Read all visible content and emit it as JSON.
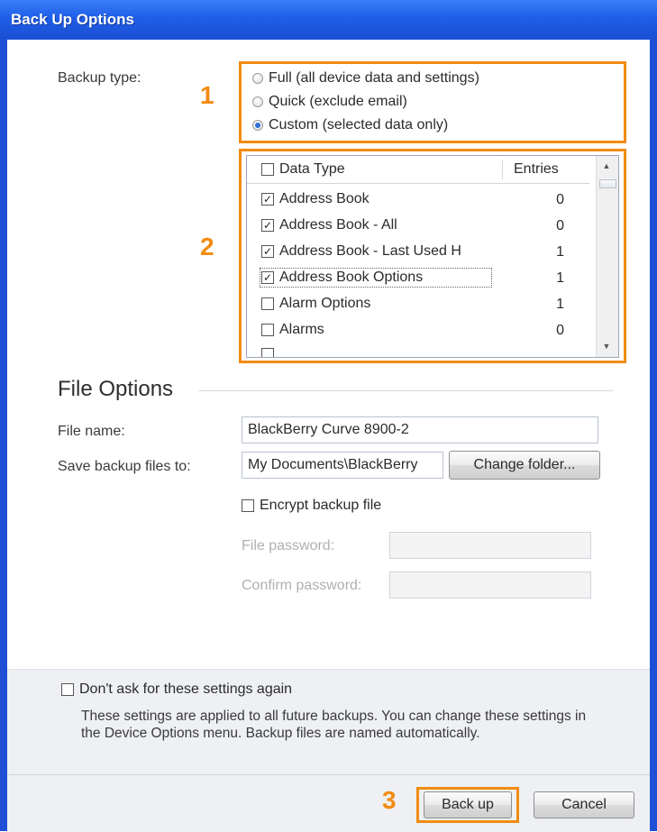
{
  "window": {
    "title": "Back Up Options"
  },
  "backup_type": {
    "label": "Backup type:",
    "options": [
      {
        "label": "Full (all device data and settings)",
        "selected": false
      },
      {
        "label": "Quick (exclude email)",
        "selected": false
      },
      {
        "label": "Custom (selected data only)",
        "selected": true
      }
    ]
  },
  "annotations": {
    "step1": "1",
    "step2": "2",
    "step3": "3",
    "accent_color": "#f28c12"
  },
  "data_table": {
    "header": {
      "data_type": "Data Type",
      "entries": "Entries",
      "all_checked": false
    },
    "rows": [
      {
        "name": "Address Book",
        "entries": "0",
        "checked": true
      },
      {
        "name": "Address Book - All",
        "entries": "0",
        "checked": true
      },
      {
        "name": "Address Book - Last Used H",
        "entries": "1",
        "checked": true
      },
      {
        "name": "Address Book Options",
        "entries": "1",
        "checked": true
      },
      {
        "name": "Alarm Options",
        "entries": "1",
        "checked": false
      },
      {
        "name": "Alarms",
        "entries": "0",
        "checked": false
      }
    ]
  },
  "file_options": {
    "title": "File Options",
    "file_name_label": "File name:",
    "file_name_value": "BlackBerry Curve 8900-2",
    "save_to_label": "Save backup files to:",
    "save_to_value": "My Documents\\BlackBerry",
    "change_folder_button": "Change folder...",
    "encrypt_label": "Encrypt backup file",
    "encrypt_checked": false,
    "password_label": "File password:",
    "password_value": "",
    "confirm_label": "Confirm password:",
    "confirm_value": ""
  },
  "footer": {
    "dont_ask_label": "Don't ask for these settings again",
    "dont_ask_checked": false,
    "note": "These settings are applied to all future backups. You can change these settings in the Device Options menu. Backup files are named automatically.",
    "backup_button": "Back up",
    "cancel_button": "Cancel"
  }
}
